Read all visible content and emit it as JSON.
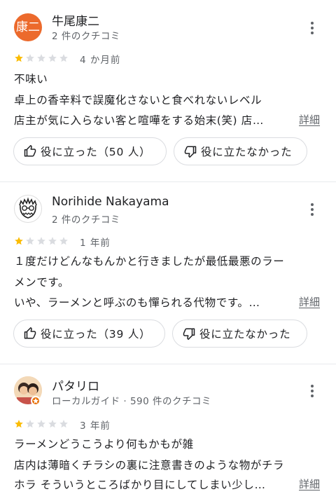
{
  "reviews": [
    {
      "avatar_text": "康二",
      "name": "牛尾康二",
      "meta": "2 件のクチコミ",
      "rating": 1,
      "time": "4 か月前",
      "text_lines": [
        "不味い",
        "卓上の香辛料で誤魔化さないと食べれないレベル",
        "店主が気に入らない客と喧嘩をする始末(笑) 店…"
      ],
      "more_label": "詳細",
      "helpful_label": "役に立った（50 人）",
      "not_helpful_label": "役に立たなかった"
    },
    {
      "name": "Norihide Nakayama",
      "meta": "2 件のクチコミ",
      "rating": 1,
      "time": "1 年前",
      "text_lines": [
        "１度だけどんなもんかと行きましたが最低最悪のラー",
        "メンです。",
        "いや、ラーメンと呼ぶのも憚られる代物です。…"
      ],
      "more_label": "詳細",
      "helpful_label": "役に立った（39 人）",
      "not_helpful_label": "役に立たなかった"
    },
    {
      "name": "パタリロ",
      "meta": "ローカルガイド · 590 件のクチコミ",
      "rating": 1,
      "time": "3 年前",
      "text_lines": [
        "ラーメンどうこうより何もかもが雑",
        "店内は薄暗くチラシの裏に注意書きのような物がチラ",
        "ホラ そういうところばかり目にしてしまい少し…"
      ],
      "more_label": "詳細"
    }
  ],
  "colors": {
    "star_filled": "#fbbc04",
    "star_empty": "#dadce0",
    "avatar_orange": "#ec6a2c",
    "badge_orange": "#e8710a"
  },
  "icons": {
    "more": "more-vert-icon",
    "thumb_up": "thumb-up-icon",
    "thumb_down": "thumb-down-icon",
    "star": "star-icon",
    "local_guide": "local-guide-badge-icon"
  }
}
